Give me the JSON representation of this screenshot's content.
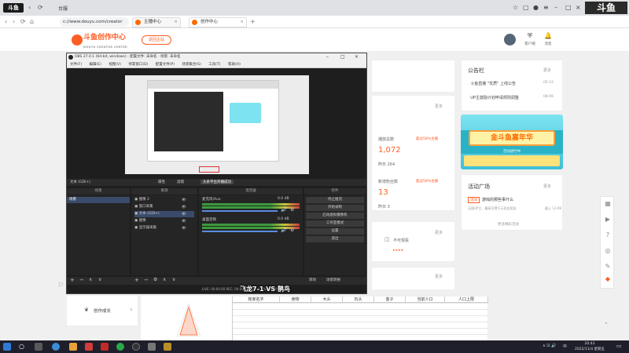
{
  "browser": {
    "tab_text": "台服",
    "url": "c://www.douyu.com/creator",
    "tabs": [
      {
        "label": "主播中心"
      },
      {
        "label": "创作中心"
      }
    ]
  },
  "site": {
    "brand_name": "斗鱼创作中心",
    "brand_sub": "DOUYU CREATOR CENTER",
    "back_button": "返回主站",
    "header_items": [
      {
        "label": "客户端"
      },
      {
        "label": "消息"
      }
    ]
  },
  "notice_board": {
    "title": "公告栏",
    "more": "更多",
    "items": [
      {
        "text": "斗鱼直播 \"优质\" 上线公告",
        "date": "05-15"
      },
      {
        "text": "UP主激励计划申请规则调整",
        "date": "08-06"
      }
    ]
  },
  "banner": {
    "headline": "金斗鱼嘉年华",
    "subline": "活动进行中"
  },
  "activity": {
    "title": "活动广场",
    "more": "更多",
    "tag": "活动",
    "item": "游戏的那些事什么",
    "desc": "无限UP主，最高可得千元现金奖励",
    "date": "截止 12-08",
    "more_link": "更多精彩活动"
  },
  "stats": {
    "more1": "更多",
    "label1": "播放总数",
    "trend1": "超过58%主播",
    "value1": "1,072",
    "sub1": "昨日 264",
    "label2": "新增粉丝数",
    "trend2": "超过58%主播",
    "value2": "13",
    "sub2": "昨日 3",
    "more2": "更多",
    "review_label": "不可观看",
    "more3": "更多"
  },
  "left_nav": {
    "item": "创作成长"
  },
  "obs": {
    "title": "OBS 27.0.1 (64-bit, windows) - 配置文件: 未命名 - 场景: 未命名",
    "menu": [
      "文件(F)",
      "编辑(E)",
      "视图(V)",
      "停靠窗口(D)",
      "配置文件(P)",
      "场景集合(S)",
      "工具(T)",
      "帮助(H)"
    ],
    "scene_label": "文本 (GDI+)",
    "props": "属性",
    "filters": "滤镜",
    "recording": "头条平台开播成功",
    "panels": {
      "scenes": "场景",
      "sources": "来源",
      "mixer": "混音器",
      "controls": "控件"
    },
    "scene_items": [
      "场景"
    ],
    "sources": [
      "图像 2",
      "窗口采集",
      "文本 (GDI+)",
      "图像",
      "显示器采集"
    ],
    "mixer_tracks": [
      {
        "name": "麦克风/Aux",
        "db": "0.0 dB"
      },
      {
        "name": "桌面音频",
        "db": "0.0 dB"
      }
    ],
    "controls": [
      "停止推流",
      "开始录制",
      "启动虚拟摄像机",
      "工作室模式",
      "设置",
      "退出"
    ],
    "bottom_tabs": [
      "转场",
      "场景转换"
    ],
    "status": "LIVE: 00:00:00  REC: 00:00:00  CPU: 2.1%, 60.00 fps",
    "transition": "飞龙7-1 VS 鹊鸟"
  },
  "caption": "飞龙7-1 VS 鹊鸟",
  "sheet": {
    "headers": [
      "帐家名字",
      "食物",
      "木头",
      "石头",
      "金子",
      "当前人口",
      "人口上限"
    ]
  },
  "taskbar": {
    "time": "20:43",
    "date": "2022/11/4 星期五",
    "lang": "中"
  }
}
